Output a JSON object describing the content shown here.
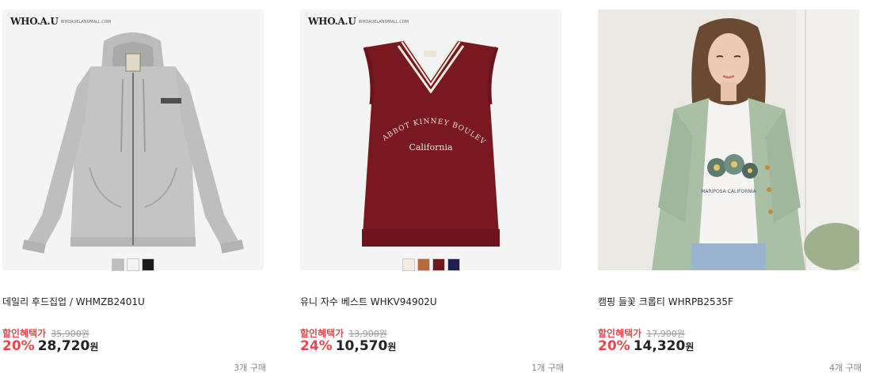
{
  "products": [
    {
      "brand": "WHO.A.U",
      "brand_site": "WHOAUELANDMALL.COM",
      "image": "gray-zip-hoodie",
      "swatches": [
        "#bdbdbd",
        "#f3f3f3",
        "#1c1c1c"
      ],
      "title": "데일리 후드집업 / WHMZB2401U",
      "promo_label": "할인혜택가",
      "original_price": "35,900원",
      "discount": "20%",
      "price": "28,720",
      "currency": "원",
      "sold": "3개 구매"
    },
    {
      "brand": "WHO.A.U",
      "brand_site": "WHOAUELANDMALL.COM",
      "image": "burgundy-knit-vest",
      "embroidery_arc": "ABBOT KINNEY BOULEVARD",
      "embroidery_text": "California",
      "swatches": [
        "#f3ece0",
        "#b36a3f",
        "#6e1a1c",
        "#1f2150"
      ],
      "title": "유니 자수 베스트 WHKV94902U",
      "promo_label": "할인혜택가",
      "original_price": "13,900원",
      "discount": "24%",
      "price": "10,570",
      "currency": "원",
      "sold": "1개 구매"
    },
    {
      "image": "model-mint-cardigan-crop-tee",
      "tee_print": "MARIPOSA CALIFORNIA",
      "swatches": [],
      "title": "캠핑 들꽃 크롭티 WHRPB2535F",
      "promo_label": "할인혜택가",
      "original_price": "17,900원",
      "discount": "20%",
      "price": "14,320",
      "currency": "원",
      "sold": "4개 구매"
    }
  ],
  "colors": {
    "accent": "#e8474f",
    "muted": "#9a9a9a"
  }
}
